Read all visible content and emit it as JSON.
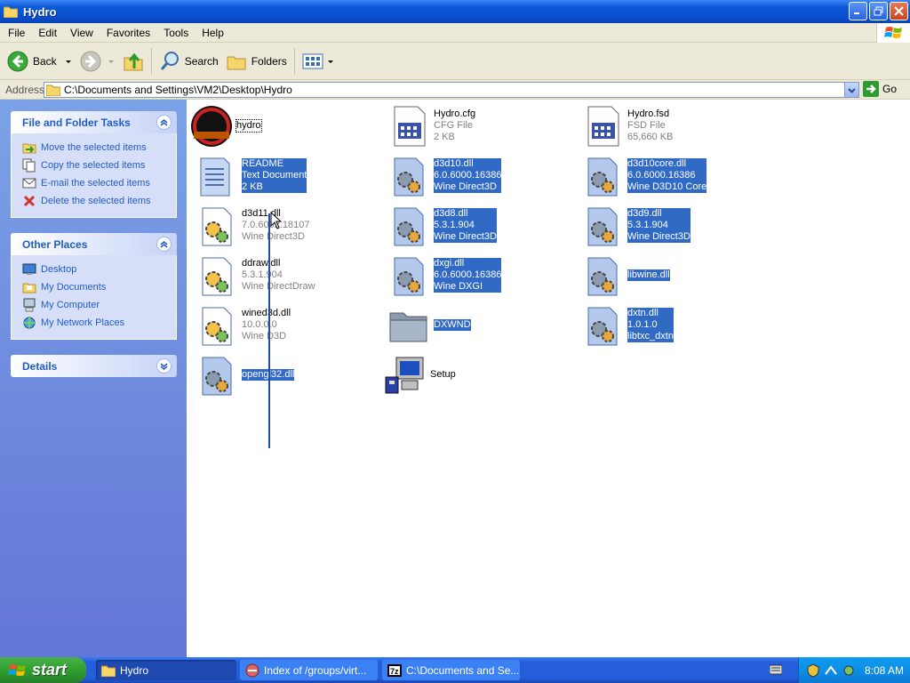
{
  "window": {
    "title": "Hydro"
  },
  "menu": [
    "File",
    "Edit",
    "View",
    "Favorites",
    "Tools",
    "Help"
  ],
  "toolbar": {
    "back": "Back",
    "search": "Search",
    "folders": "Folders"
  },
  "address": {
    "label": "Address",
    "path": "C:\\Documents and Settings\\VM2\\Desktop\\Hydro",
    "go": "Go"
  },
  "tasks": {
    "file_folder": {
      "title": "File and Folder Tasks",
      "items": [
        "Move the selected items",
        "Copy the selected items",
        "E-mail the selected items",
        "Delete the selected items"
      ]
    },
    "other_places": {
      "title": "Other Places",
      "items": [
        "Desktop",
        "My Documents",
        "My Computer",
        "My Network Places"
      ]
    },
    "details": {
      "title": "Details"
    }
  },
  "files": [
    {
      "name": "hydro",
      "icon": "hydro-app-icon",
      "lines": [],
      "selected": false
    },
    {
      "name": "Hydro.cfg",
      "icon": "cfg-file-icon",
      "lines": [
        "CFG File",
        "2 KB"
      ],
      "selected": false
    },
    {
      "name": "Hydro.fsd",
      "icon": "fsd-file-icon",
      "lines": [
        "FSD File",
        "65,660 KB"
      ],
      "selected": false
    },
    {
      "name": "README",
      "icon": "text-document-icon",
      "lines": [
        "Text Document",
        "2 KB"
      ],
      "selected": true
    },
    {
      "name": "d3d10.dll",
      "icon": "dll-gear-icon",
      "lines": [
        "6.0.6000.16386",
        "Wine Direct3D"
      ],
      "selected": true
    },
    {
      "name": "d3d10core.dll",
      "icon": "dll-gear-icon",
      "lines": [
        "6.0.6000.16386",
        "Wine D3D10 Core"
      ],
      "selected": true
    },
    {
      "name": "d3d11.dll",
      "icon": "dll-gear-icon",
      "lines": [
        "7.0.6002.18107",
        "Wine Direct3D"
      ],
      "selected": false
    },
    {
      "name": "d3d8.dll",
      "icon": "dll-gear-icon",
      "lines": [
        "5.3.1.904",
        "Wine Direct3D"
      ],
      "selected": true
    },
    {
      "name": "d3d9.dll",
      "icon": "dll-gear-icon",
      "lines": [
        "5.3.1.904",
        "Wine Direct3D"
      ],
      "selected": true
    },
    {
      "name": "ddraw.dll",
      "icon": "dll-gear-icon",
      "lines": [
        "5.3.1.904",
        "Wine DirectDraw"
      ],
      "selected": false
    },
    {
      "name": "dxgi.dll",
      "icon": "dll-gear-icon",
      "lines": [
        "6.0.6000.16386",
        "Wine DXGI"
      ],
      "selected": true
    },
    {
      "name": "libwine.dll",
      "icon": "dll-gear-icon",
      "lines": [],
      "selected": true
    },
    {
      "name": "wined3d.dll",
      "icon": "dll-gear-icon",
      "lines": [
        "10.0.0.0",
        "Wine D3D"
      ],
      "selected": false
    },
    {
      "name": "DXWND",
      "icon": "folder-icon",
      "lines": [],
      "selected": true
    },
    {
      "name": "dxtn.dll",
      "icon": "dll-gear-icon",
      "lines": [
        "1.0.1.0",
        "libtxc_dxtn"
      ],
      "selected": true
    },
    {
      "name": "opengl32.dll",
      "icon": "dll-gear-icon",
      "lines": [],
      "selected": true
    },
    {
      "name": "Setup",
      "icon": "setup-computer-icon",
      "lines": [],
      "selected": false
    }
  ],
  "taskbar": {
    "start": "start",
    "buttons": [
      "Hydro",
      "Index of /groups/virt...",
      "C:\\Documents and Se..."
    ],
    "clock": "8:08 AM"
  },
  "colors": {
    "selection": "#316ac5",
    "link": "#215dc6",
    "titlebar": "#0a4fcd"
  }
}
